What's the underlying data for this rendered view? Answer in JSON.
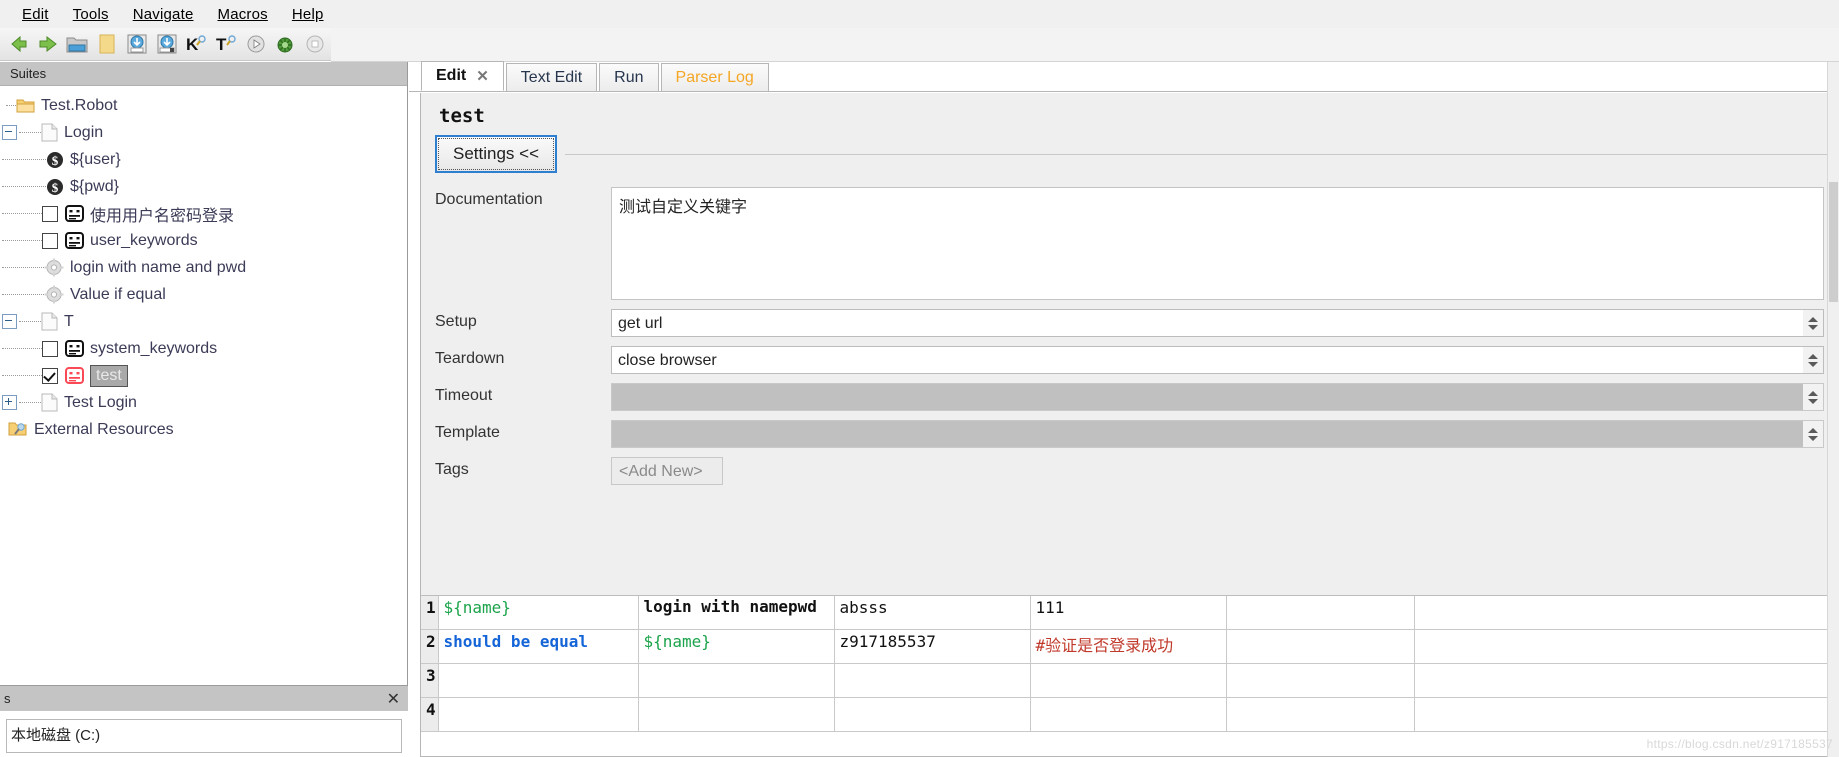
{
  "menu": {
    "items": [
      {
        "label": "Edit",
        "mnemonic": "E"
      },
      {
        "label": "Tools",
        "mnemonic": "T"
      },
      {
        "label": "Navigate",
        "mnemonic": "N"
      },
      {
        "label": "Macros",
        "mnemonic": "M"
      },
      {
        "label": "Help",
        "mnemonic": "H"
      }
    ]
  },
  "toolbar": {
    "buttons": [
      {
        "name": "go-back-icon",
        "title": "Back"
      },
      {
        "name": "go-forward-icon",
        "title": "Forward"
      },
      {
        "name": "open-folder-icon",
        "title": "Open Directory"
      },
      {
        "name": "new-file-icon",
        "title": "New File"
      },
      {
        "name": "save-icon",
        "title": "Save"
      },
      {
        "name": "save-all-icon",
        "title": "Save All"
      },
      {
        "name": "new-keyword-icon",
        "title": "K"
      },
      {
        "name": "new-testcase-icon",
        "title": "T"
      },
      {
        "name": "run-icon",
        "title": "Start"
      },
      {
        "name": "debug-icon",
        "title": "Debug"
      },
      {
        "name": "stop-icon",
        "title": "Stop"
      }
    ]
  },
  "sidebar": {
    "header": "Suites",
    "tree": [
      {
        "label": "Test.Robot",
        "icon": "folder-icon",
        "indent": 0,
        "expander": "none",
        "checkbox": "none",
        "selected": false
      },
      {
        "label": "Login",
        "icon": "file-icon",
        "indent": 1,
        "expander": "minus",
        "checkbox": "none",
        "selected": false
      },
      {
        "label": "${user}",
        "icon": "variable-icon",
        "indent": 2,
        "expander": "none",
        "checkbox": "none",
        "selected": false
      },
      {
        "label": "${pwd}",
        "icon": "variable-icon",
        "indent": 2,
        "expander": "none",
        "checkbox": "none",
        "selected": false
      },
      {
        "label": "使用用户名密码登录",
        "icon": "testcase-icon",
        "indent": 2,
        "expander": "none",
        "checkbox": "off",
        "selected": false
      },
      {
        "label": "user_keywords",
        "icon": "testcase-icon",
        "indent": 2,
        "expander": "none",
        "checkbox": "off",
        "selected": false
      },
      {
        "label": "login with name and pwd",
        "icon": "keyword-icon",
        "indent": 2,
        "expander": "none",
        "checkbox": "none",
        "selected": false
      },
      {
        "label": "Value if equal",
        "icon": "keyword-icon",
        "indent": 2,
        "expander": "none",
        "checkbox": "none",
        "selected": false
      },
      {
        "label": "T",
        "icon": "file-icon",
        "indent": 1,
        "expander": "minus",
        "checkbox": "none",
        "selected": false
      },
      {
        "label": "system_keywords",
        "icon": "testcase-icon",
        "indent": 2,
        "expander": "none",
        "checkbox": "off",
        "selected": false
      },
      {
        "label": "test",
        "icon": "testcase-icon-red",
        "indent": 2,
        "expander": "none",
        "checkbox": "on",
        "selected": true
      },
      {
        "label": "Test Login",
        "icon": "file-icon",
        "indent": 1,
        "expander": "plus",
        "checkbox": "none",
        "selected": false
      },
      {
        "label": "External Resources",
        "icon": "resources-icon",
        "indent": 0,
        "expander": "none",
        "checkbox": "none",
        "selected": false
      }
    ]
  },
  "bottom_panel": {
    "title": "s",
    "close_label": "✕",
    "content": "本地磁盘 (C:)"
  },
  "tabs": [
    {
      "label": "Edit",
      "active": true,
      "closable": true,
      "close_label": "✕",
      "style": "normal"
    },
    {
      "label": "Text Edit",
      "active": false,
      "closable": false,
      "style": "normal"
    },
    {
      "label": "Run",
      "active": false,
      "closable": false,
      "style": "normal"
    },
    {
      "label": "Parser Log",
      "active": false,
      "closable": false,
      "style": "warn"
    }
  ],
  "editor": {
    "title": "test",
    "settings_button": "Settings <<",
    "fields": [
      {
        "label": "Documentation",
        "value": "测试自定义关键字",
        "type": "textarea",
        "disabled": false
      },
      {
        "label": "Setup",
        "value": "get url",
        "type": "combo",
        "disabled": false
      },
      {
        "label": "Teardown",
        "value": "close browser",
        "type": "combo",
        "disabled": false
      },
      {
        "label": "Timeout",
        "value": "",
        "type": "combo",
        "disabled": true
      },
      {
        "label": "Template",
        "value": "",
        "type": "combo",
        "disabled": true
      },
      {
        "label": "Tags",
        "value": "<Add New>",
        "type": "tags",
        "disabled": false
      }
    ]
  },
  "grid": {
    "rows": [
      {
        "num": "1",
        "cells": [
          {
            "text": "${name}",
            "style": "var"
          },
          {
            "text": "login with namepwd",
            "style": "bold"
          },
          {
            "text": "absss",
            "style": "plain"
          },
          {
            "text": "111",
            "style": "plain"
          },
          {
            "text": "",
            "style": "plain"
          }
        ]
      },
      {
        "num": "2",
        "cells": [
          {
            "text": "should be equal",
            "style": "kw"
          },
          {
            "text": "${name}",
            "style": "var"
          },
          {
            "text": "z917185537",
            "style": "plain"
          },
          {
            "text": "#验证是否登录成功",
            "style": "cmt"
          },
          {
            "text": "",
            "style": "plain"
          }
        ]
      },
      {
        "num": "3",
        "cells": [
          {
            "text": "",
            "style": "plain"
          },
          {
            "text": "",
            "style": "plain"
          },
          {
            "text": "",
            "style": "plain"
          },
          {
            "text": "",
            "style": "plain"
          },
          {
            "text": "",
            "style": "plain"
          }
        ]
      },
      {
        "num": "4",
        "cells": [
          {
            "text": "",
            "style": "plain"
          },
          {
            "text": "",
            "style": "plain"
          },
          {
            "text": "",
            "style": "plain"
          },
          {
            "text": "",
            "style": "plain"
          },
          {
            "text": "",
            "style": "plain"
          }
        ]
      }
    ]
  },
  "watermark": "https://blog.csdn.net/z917185537",
  "colors": {
    "accent": "#2f7fd0",
    "variable_green": "#1aa34a",
    "keyword_blue": "#1565d8",
    "comment_red": "#c0392b",
    "tab_warn": "#f5a623",
    "selection_gray": "#a9a9a9"
  }
}
